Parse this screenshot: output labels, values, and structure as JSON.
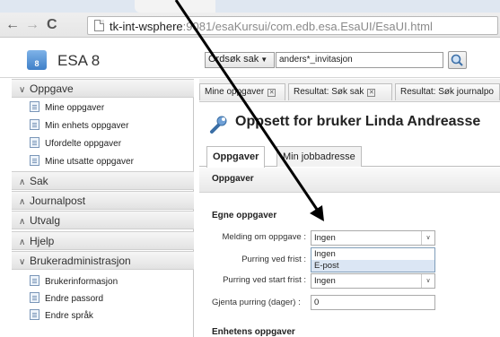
{
  "browser": {
    "url_host": "tk-int-wsphere",
    "url_rest": ":9081/esaKursui/com.edb.esa.EsaUI/EsaUI.html"
  },
  "header": {
    "logo_text": "8",
    "app_title": "ESA 8",
    "search_type": "Ordsøk sak",
    "search_value": "anders*_invitasjon"
  },
  "sidebar": {
    "sections": [
      {
        "label": "Oppgave",
        "expanded": true,
        "items": [
          "Mine oppgaver",
          "Min enhets oppgaver",
          "Ufordelte oppgaver",
          "Mine utsatte oppgaver"
        ]
      },
      {
        "label": "Sak",
        "expanded": false
      },
      {
        "label": "Journalpost",
        "expanded": false
      },
      {
        "label": "Utvalg",
        "expanded": false
      },
      {
        "label": "Hjelp",
        "expanded": false
      },
      {
        "label": "Brukeradministrasjon",
        "expanded": true,
        "items": [
          "Brukerinformasjon",
          "Endre passord",
          "Endre språk"
        ]
      }
    ]
  },
  "tabs": [
    {
      "label": "Mine oppgaver"
    },
    {
      "label": "Resultat: Søk sak"
    },
    {
      "label": "Resultat: Søk journalpo"
    }
  ],
  "page": {
    "title": "Oppsett for bruker Linda Andreasse",
    "inner_tabs": [
      "Oppgaver",
      "Min jobbadresse"
    ],
    "panel_title": "Oppgaver",
    "group1_title": "Egne oppgaver",
    "group2_title": "Enhetens oppgaver",
    "fields": {
      "melding_label": "Melding om oppgave :",
      "melding_value": "Ingen",
      "purring_frist_label": "Purring ved frist :",
      "purring_start_label": "Purring ved start frist :",
      "purring_start_value": "Ingen",
      "gjenta_label": "Gjenta purring (dager) :",
      "gjenta_value": "0"
    },
    "dropdown_options": [
      "Ingen",
      "E-post"
    ]
  }
}
